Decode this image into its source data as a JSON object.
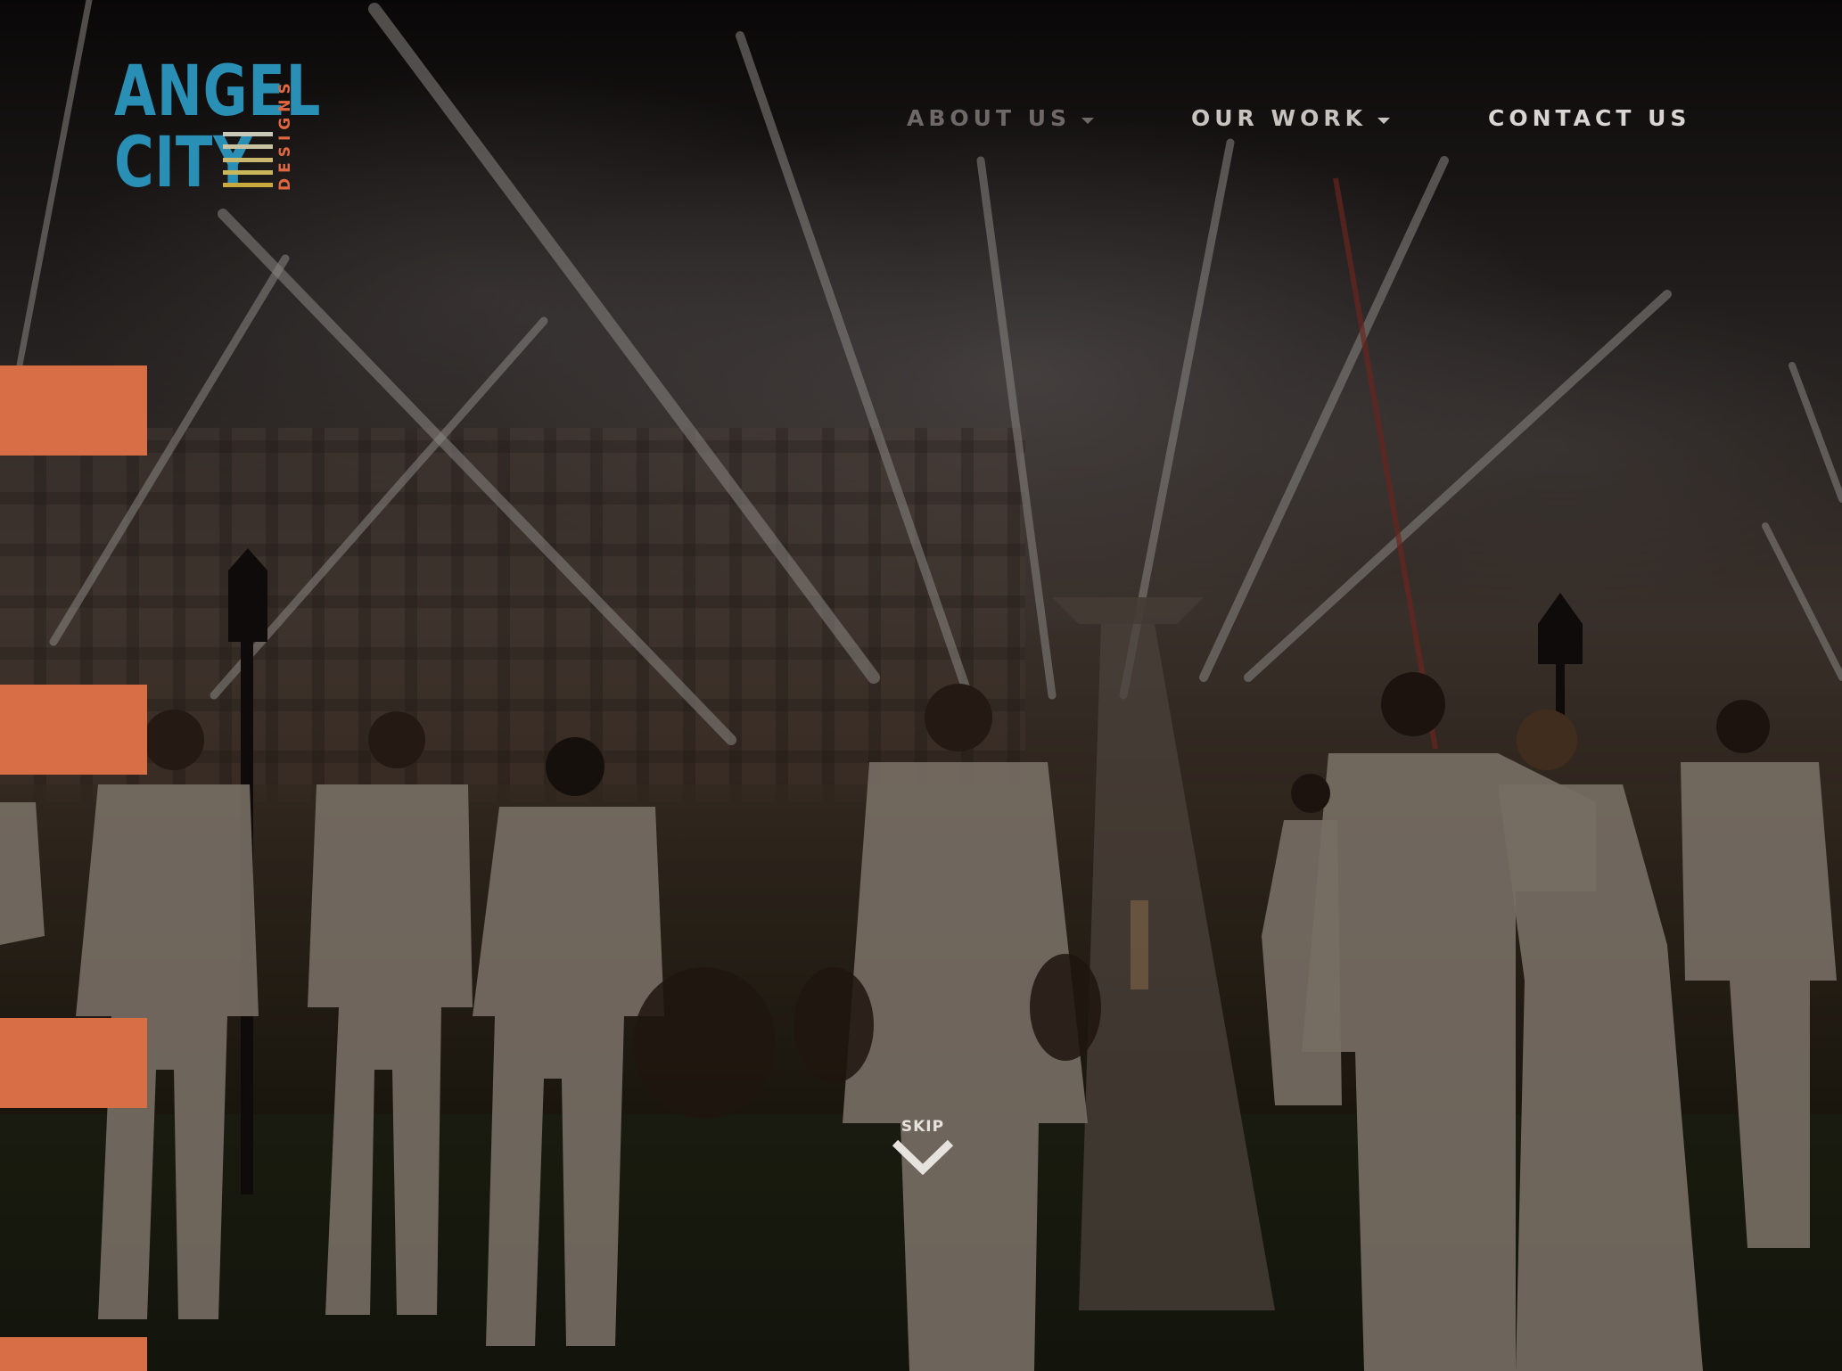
{
  "logo": {
    "line1": "ANGEL",
    "line2": "CITY",
    "tagline": "DESIGNS"
  },
  "nav": {
    "items": [
      {
        "label": "ABOUT US",
        "has_dropdown": true
      },
      {
        "label": "OUR WORK",
        "has_dropdown": true
      },
      {
        "label": "CONTACT US",
        "has_dropdown": false
      }
    ]
  },
  "hero": {
    "skip_label": "SKIP",
    "skip_icon": "chevron-down-icon"
  },
  "colors": {
    "accent": "#d86e45",
    "logo_blue": "#2a8fb4",
    "logo_orange": "#e0673f"
  }
}
